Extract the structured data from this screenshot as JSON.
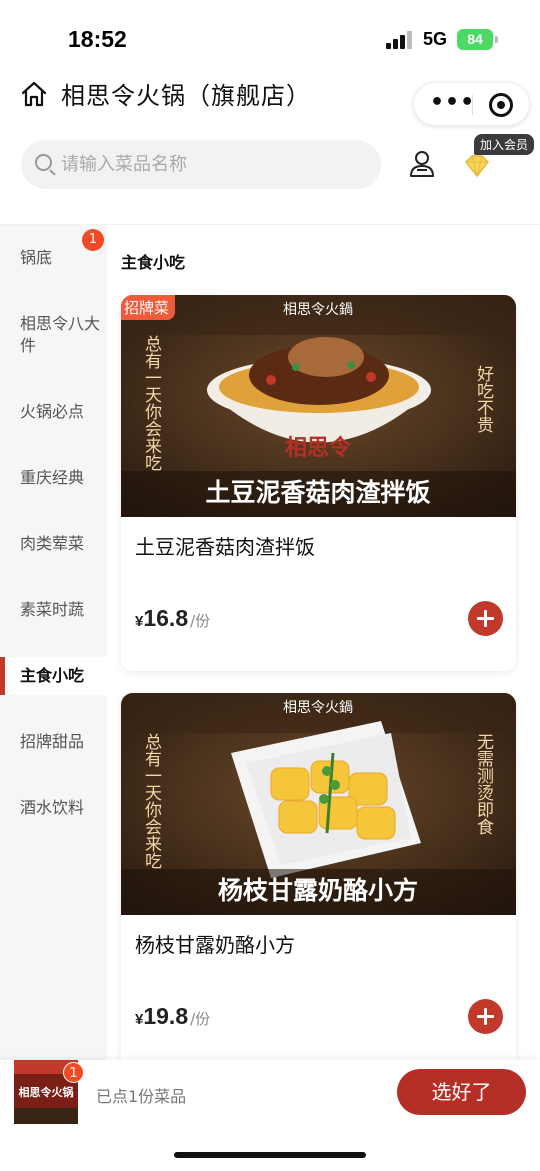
{
  "status_bar": {
    "time": "18:52",
    "network": "5G",
    "battery": "84"
  },
  "header": {
    "title": "相思令火锅（旗舰店）",
    "more_label": "•••"
  },
  "search": {
    "placeholder": "请输入菜品名称",
    "member_badge": "加入会员"
  },
  "categories": [
    {
      "label": "锅底",
      "badge": "1"
    },
    {
      "label": "相思令八大件"
    },
    {
      "label": "火锅必点"
    },
    {
      "label": "重庆经典"
    },
    {
      "label": "肉类荤菜"
    },
    {
      "label": "素菜时蔬"
    },
    {
      "label": "主食小吃",
      "active": true
    },
    {
      "label": "招牌甜品"
    },
    {
      "label": "酒水饮料"
    }
  ],
  "section_title": "主食小吃",
  "dishes": [
    {
      "tag": "招牌菜",
      "name": "土豆泥香菇肉渣拌饭",
      "currency": "¥",
      "price": "16.8",
      "unit": "/份",
      "image_text": {
        "brand": "相思令火鍋",
        "left": "总有一天你会来吃",
        "right": "好吃不贵",
        "bowl": "相思令",
        "banner": "土豆泥香菇肉渣拌饭"
      }
    },
    {
      "name": "杨枝甘露奶酪小方",
      "currency": "¥",
      "price": "19.8",
      "unit": "/份",
      "image_text": {
        "brand": "相思令火鍋",
        "left": "总有一天你会来吃",
        "right": "无需测烫即食",
        "banner": "杨枝甘露奶酪小方"
      }
    }
  ],
  "cart": {
    "count": "1",
    "summary": "已点1份菜品",
    "thumb_text": "相思令火锅",
    "checkout_label": "选好了"
  },
  "colors": {
    "accent": "#b52f27",
    "badge": "#f04b24",
    "tag": "#f05a3a"
  }
}
